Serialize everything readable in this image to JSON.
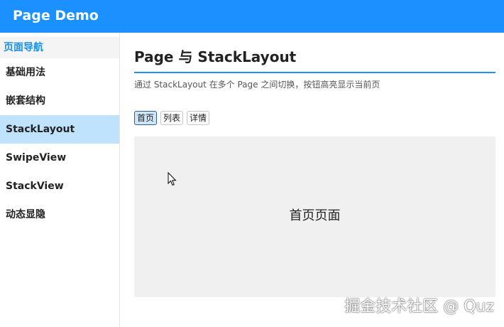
{
  "header": {
    "title": "Page Demo"
  },
  "sidebar": {
    "title": "页面导航",
    "items": [
      {
        "label": "基础用法"
      },
      {
        "label": "嵌套结构"
      },
      {
        "label": "StackLayout",
        "active": true
      },
      {
        "label": "SwipeView"
      },
      {
        "label": "StackView"
      },
      {
        "label": "动态显隐"
      }
    ]
  },
  "main": {
    "title": "Page 与 StackLayout",
    "description": "通过 StackLayout 在多个 Page 之间切换，按钮高亮显示当前页",
    "buttons": [
      {
        "label": "首页",
        "active": true
      },
      {
        "label": "列表"
      },
      {
        "label": "详情"
      }
    ],
    "current_page_text": "首页页面"
  },
  "watermark": "掘金技术社区 @ Quz",
  "colors": {
    "header_bg": "#1a91ff",
    "accent": "#1a8fe6",
    "active_item_bg": "#bfe3fd",
    "page_view_bg": "#f0f0f0"
  }
}
